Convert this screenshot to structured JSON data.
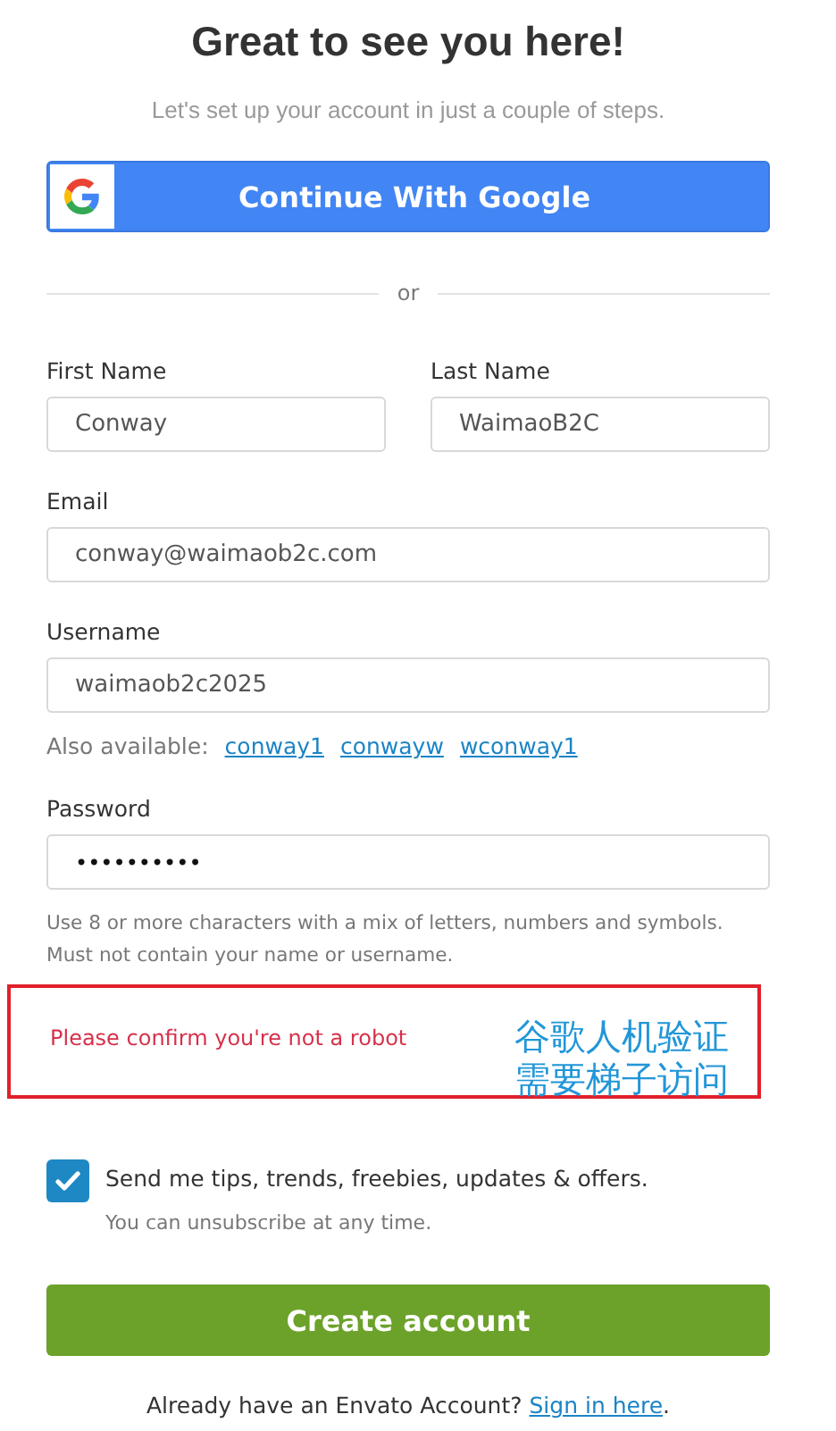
{
  "title": "Great to see you here!",
  "subtitle": "Let's set up your account in just a couple of steps.",
  "google_button": {
    "label": "Continue With Google"
  },
  "divider_text": "or",
  "name_fields": [
    {
      "label": "First Name",
      "value": "Conway"
    },
    {
      "label": "Last Name",
      "value": "WaimaoB2C"
    }
  ],
  "email": {
    "label": "Email",
    "value": "conway@waimaob2c.com"
  },
  "username": {
    "label": "Username",
    "value": "waimaob2c2025"
  },
  "also_available": {
    "label": "Also available:",
    "options": [
      "conway1",
      "conwayw",
      "wconway1"
    ]
  },
  "password": {
    "label": "Password",
    "value": "••••••••••",
    "hint": [
      "Use 8 or more characters with a mix of letters, numbers and symbols.",
      "Must not contain your name or username."
    ]
  },
  "captcha_error": "Please confirm you're not a robot",
  "annotation": [
    "谷歌人机验证",
    "需要梯子访问"
  ],
  "newsletter": {
    "label": "Send me tips, trends, freebies, updates & offers.",
    "checked": true,
    "note": "You can unsubscribe at any time."
  },
  "create_button": {
    "label": "Create account"
  },
  "footer": {
    "text": "Already have an Envato Account?",
    "link": "Sign in here",
    "suffix": "."
  }
}
